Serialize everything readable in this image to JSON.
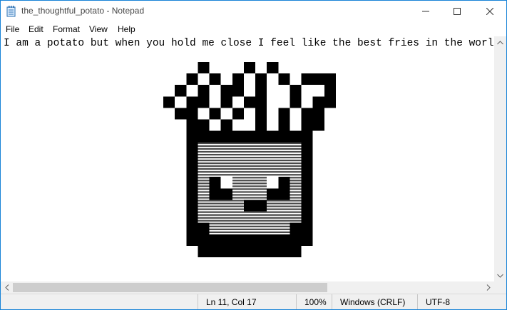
{
  "window": {
    "title": "the_thoughtful_potato - Notepad"
  },
  "menu": {
    "items": [
      {
        "label": "File"
      },
      {
        "label": "Edit"
      },
      {
        "label": "Format"
      },
      {
        "label": "View"
      },
      {
        "label": "Help"
      }
    ]
  },
  "editor": {
    "first_line": "I am a potato but when you hold me close I feel like the best fries in the world! -fw"
  },
  "status": {
    "position": "Ln 11, Col 17",
    "zoom": "100%",
    "line_ending": "Windows (CRLF)",
    "encoding": "UTF-8"
  },
  "icons": {
    "app": "notepad-icon",
    "minimize": "minimize-icon",
    "maximize": "maximize-icon",
    "close": "close-icon"
  },
  "colors": {
    "window_border": "#1883d7",
    "statusbar_bg": "#f0f0f0",
    "scrollbar_thumb": "#cdcdcd",
    "art_ink": "#000000",
    "art_shade": "#c8c8c8"
  }
}
